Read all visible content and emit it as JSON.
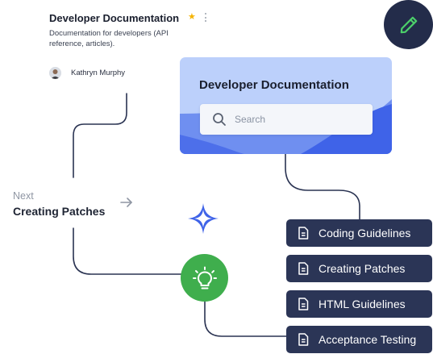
{
  "doc_card": {
    "title": "Developer Documentation",
    "description": "Documentation for developers (API reference, articles).",
    "author": "Kathryn Murphy",
    "starred": true,
    "star_color": "#f5b301"
  },
  "search_card": {
    "title": "Developer Documentation",
    "placeholder": "Search"
  },
  "next": {
    "label": "Next",
    "title": "Creating Patches"
  },
  "doc_links": [
    {
      "label": "Coding Guidelines"
    },
    {
      "label": "Creating Patches"
    },
    {
      "label": "HTML Guidelines"
    },
    {
      "label": "Acceptance Testing"
    }
  ],
  "icons": {
    "edit": "pencil-icon",
    "idea": "lightbulb-icon",
    "ai": "sparkle-icon",
    "doc": "document-icon"
  },
  "colors": {
    "dark_navy": "#232c4a",
    "button_navy": "#2b3556",
    "green": "#3fae4d",
    "blue_accent": "#3f63e8",
    "card_light_blue": "#bcd0fb",
    "line_color": "#2a3352"
  }
}
